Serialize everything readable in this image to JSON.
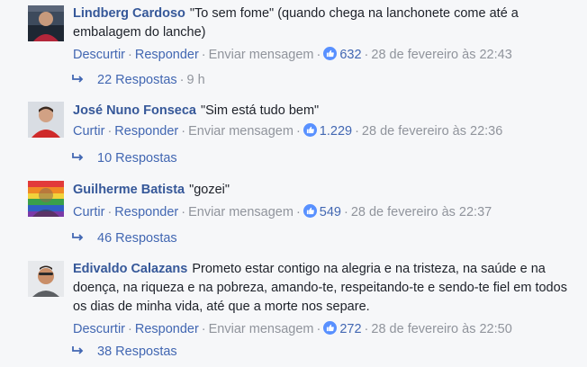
{
  "labels": {
    "reply": "Responder",
    "message": "Enviar mensagem",
    "dot": "·"
  },
  "comments": [
    {
      "author": "Lindberg Cardoso",
      "text": "\"To sem fome\" (quando chega na lanchonete come até a embalagem do lanche)",
      "action": "Descurtir",
      "likes": "632",
      "timestamp": "28 de fevereiro às 22:43",
      "replies": "22 Respostas",
      "reply_time": "9 h"
    },
    {
      "author": "José Nuno Fonseca",
      "text": "\"Sim está tudo bem\"",
      "action": "Curtir",
      "likes": "1.229",
      "timestamp": "28 de fevereiro às 22:36",
      "replies": "10 Respostas"
    },
    {
      "author": "Guilherme Batista",
      "text": "\"gozei\"",
      "action": "Curtir",
      "likes": "549",
      "timestamp": "28 de fevereiro às 22:37",
      "replies": "46 Respostas"
    },
    {
      "author": "Edivaldo Calazans",
      "text": "Prometo estar contigo na alegria e na tristeza, na saúde e na doença, na riqueza e na pobreza, amando-te, respeitando-te e sendo-te fiel em todos os dias de minha vida, até que a morte nos separe.",
      "action": "Descurtir",
      "likes": "272",
      "timestamp": "28 de fevereiro às 22:50",
      "replies": "38 Respostas"
    }
  ],
  "colors": {
    "author": "#365899",
    "link": "#4267b2",
    "meta": "#90949c",
    "like_badge": "#5890ff",
    "background": "#f6f7f9"
  }
}
